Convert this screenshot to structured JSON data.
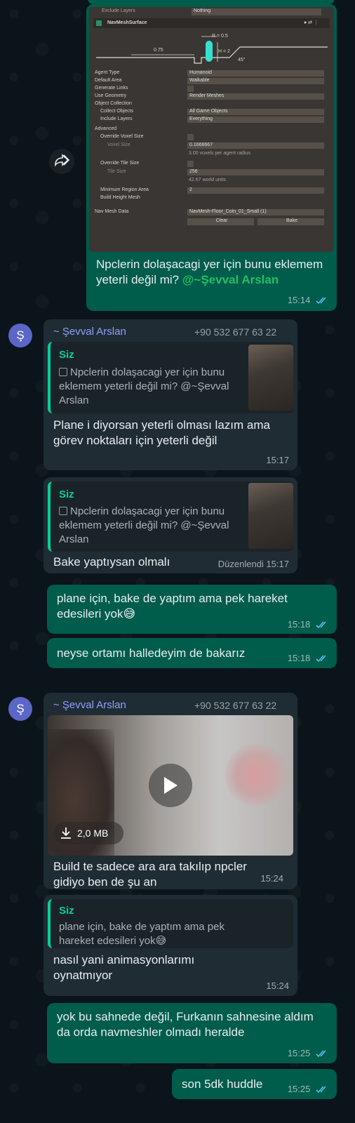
{
  "msg1": {
    "screenshot": {
      "header_label": "Exclude Layers",
      "header_value": "Nothing",
      "component_title": "NavMeshSurface",
      "diagram": {
        "r": "R = 0.5",
        "h": "H = 2",
        "w": "0.75",
        "angle": "45°"
      },
      "rows": [
        {
          "label": "Agent Type",
          "value": "Humanoid"
        },
        {
          "label": "Default Area",
          "value": "Walkable"
        },
        {
          "label": "Generate Links",
          "value": ""
        },
        {
          "label": "Use Geometry",
          "value": "Render Meshes"
        },
        {
          "label": "Object Collection",
          "value": ""
        },
        {
          "label": "Collect Objects",
          "value": "All Game Objects"
        },
        {
          "label": "Include Layers",
          "value": "Everything"
        },
        {
          "label": "Advanced",
          "value": ""
        },
        {
          "label": "Override Voxel Size",
          "value": ""
        },
        {
          "label": "Voxel Size",
          "value": "0.1666667"
        },
        {
          "label": "",
          "value": "3.00 voxels per agent radius"
        },
        {
          "label": "Override Tile Size",
          "value": ""
        },
        {
          "label": "Tile Size",
          "value": "256"
        },
        {
          "label": "",
          "value": "42.67 world units"
        },
        {
          "label": "Minimum Region Area",
          "value": "2"
        },
        {
          "label": "Build Height Mesh",
          "value": ""
        },
        {
          "label": "Nav Mesh Data",
          "value": "NavMesh-Floor_Coin_01_Small (1)"
        }
      ],
      "clear_label": "Clear",
      "bake_label": "Bake"
    },
    "text": "Npclerin dolaşacagi yer için bunu eklemem yeterli değil mi?",
    "mention": "@~Şevval Arslan",
    "time": "15:14"
  },
  "msg2": {
    "avatar": "Ş",
    "sender": "~ Şevval Arslan",
    "phone": "+90 532 677 63 22",
    "quote_name": "Siz",
    "quote_text": "Npclerin dolaşacagi yer için bunu eklemem yeterli değil mi? @~Şevval Arslan",
    "text": "Plane i diyorsan yeterli olması lazım ama görev noktaları için yeterli değil",
    "time": "15:17"
  },
  "msg3": {
    "quote_name": "Siz",
    "quote_text": "Npclerin dolaşacagi yer için bunu eklemem yeterli değil mi? @~Şevval Arslan",
    "text": "Bake yaptıysan olmalı",
    "edited": "Düzenlendi",
    "time": "15:17"
  },
  "msg4": {
    "text": "plane için, bake de yaptım ama pek hareket edesileri yok😅",
    "time": "15:18"
  },
  "msg5": {
    "text": "neyse ortamı halledeyim de bakarız",
    "time": "15:18"
  },
  "msg6": {
    "avatar": "Ş",
    "sender": "~ Şevval Arslan",
    "phone": "+90 532 677 63 22",
    "video_size": "2,0 MB",
    "text": "Build te sadece ara ara takılıp npcler gidiyo ben de şu an",
    "time": "15:24"
  },
  "msg7": {
    "quote_name": "Siz",
    "quote_text": "plane için, bake de yaptım ama pek hareket edesileri yok😅",
    "text": "nasıl yani animasyonlarımı oynatmıyor",
    "time": "15:24"
  },
  "msg8": {
    "text": "yok bu sahnede değil, Furkanın sahnesine aldım da orda navmeshler olmadı heralde",
    "time": "15:25"
  },
  "msg9": {
    "text": "son 5dk huddle",
    "time": "15:25"
  },
  "colors": {
    "outgoing": "#005c4b",
    "incoming": "#202c33",
    "accent": "#06cf9c",
    "tick_read": "#53bdeb",
    "background": "#0b141a"
  },
  "icons": [
    "forward-icon",
    "download-icon",
    "play-icon",
    "read-receipt-icon"
  ]
}
